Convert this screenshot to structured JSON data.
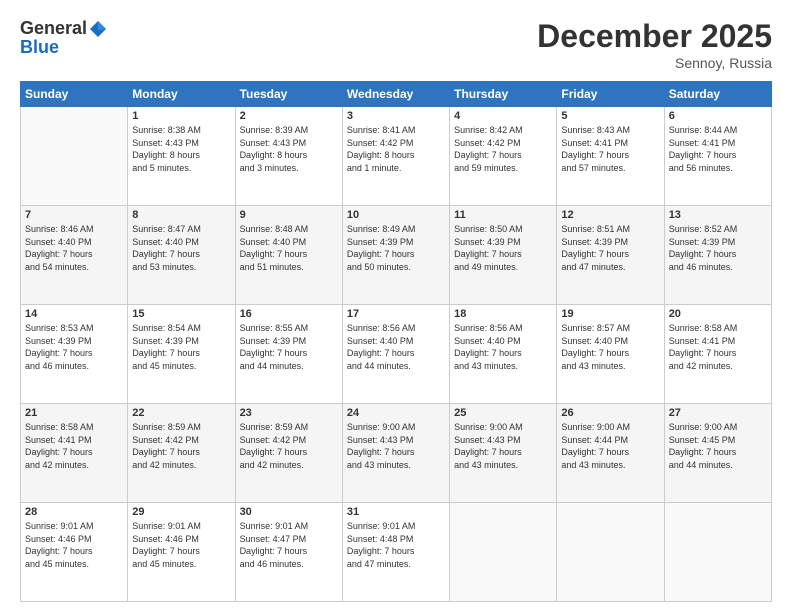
{
  "logo": {
    "general": "General",
    "blue": "Blue"
  },
  "header": {
    "title": "December 2025",
    "location": "Sennoy, Russia"
  },
  "weekdays": [
    "Sunday",
    "Monday",
    "Tuesday",
    "Wednesday",
    "Thursday",
    "Friday",
    "Saturday"
  ],
  "weeks": [
    [
      {
        "day": "",
        "info": ""
      },
      {
        "day": "1",
        "info": "Sunrise: 8:38 AM\nSunset: 4:43 PM\nDaylight: 8 hours\nand 5 minutes."
      },
      {
        "day": "2",
        "info": "Sunrise: 8:39 AM\nSunset: 4:43 PM\nDaylight: 8 hours\nand 3 minutes."
      },
      {
        "day": "3",
        "info": "Sunrise: 8:41 AM\nSunset: 4:42 PM\nDaylight: 8 hours\nand 1 minute."
      },
      {
        "day": "4",
        "info": "Sunrise: 8:42 AM\nSunset: 4:42 PM\nDaylight: 7 hours\nand 59 minutes."
      },
      {
        "day": "5",
        "info": "Sunrise: 8:43 AM\nSunset: 4:41 PM\nDaylight: 7 hours\nand 57 minutes."
      },
      {
        "day": "6",
        "info": "Sunrise: 8:44 AM\nSunset: 4:41 PM\nDaylight: 7 hours\nand 56 minutes."
      }
    ],
    [
      {
        "day": "7",
        "info": "Sunrise: 8:46 AM\nSunset: 4:40 PM\nDaylight: 7 hours\nand 54 minutes."
      },
      {
        "day": "8",
        "info": "Sunrise: 8:47 AM\nSunset: 4:40 PM\nDaylight: 7 hours\nand 53 minutes."
      },
      {
        "day": "9",
        "info": "Sunrise: 8:48 AM\nSunset: 4:40 PM\nDaylight: 7 hours\nand 51 minutes."
      },
      {
        "day": "10",
        "info": "Sunrise: 8:49 AM\nSunset: 4:39 PM\nDaylight: 7 hours\nand 50 minutes."
      },
      {
        "day": "11",
        "info": "Sunrise: 8:50 AM\nSunset: 4:39 PM\nDaylight: 7 hours\nand 49 minutes."
      },
      {
        "day": "12",
        "info": "Sunrise: 8:51 AM\nSunset: 4:39 PM\nDaylight: 7 hours\nand 47 minutes."
      },
      {
        "day": "13",
        "info": "Sunrise: 8:52 AM\nSunset: 4:39 PM\nDaylight: 7 hours\nand 46 minutes."
      }
    ],
    [
      {
        "day": "14",
        "info": "Sunrise: 8:53 AM\nSunset: 4:39 PM\nDaylight: 7 hours\nand 46 minutes."
      },
      {
        "day": "15",
        "info": "Sunrise: 8:54 AM\nSunset: 4:39 PM\nDaylight: 7 hours\nand 45 minutes."
      },
      {
        "day": "16",
        "info": "Sunrise: 8:55 AM\nSunset: 4:39 PM\nDaylight: 7 hours\nand 44 minutes."
      },
      {
        "day": "17",
        "info": "Sunrise: 8:56 AM\nSunset: 4:40 PM\nDaylight: 7 hours\nand 44 minutes."
      },
      {
        "day": "18",
        "info": "Sunrise: 8:56 AM\nSunset: 4:40 PM\nDaylight: 7 hours\nand 43 minutes."
      },
      {
        "day": "19",
        "info": "Sunrise: 8:57 AM\nSunset: 4:40 PM\nDaylight: 7 hours\nand 43 minutes."
      },
      {
        "day": "20",
        "info": "Sunrise: 8:58 AM\nSunset: 4:41 PM\nDaylight: 7 hours\nand 42 minutes."
      }
    ],
    [
      {
        "day": "21",
        "info": "Sunrise: 8:58 AM\nSunset: 4:41 PM\nDaylight: 7 hours\nand 42 minutes."
      },
      {
        "day": "22",
        "info": "Sunrise: 8:59 AM\nSunset: 4:42 PM\nDaylight: 7 hours\nand 42 minutes."
      },
      {
        "day": "23",
        "info": "Sunrise: 8:59 AM\nSunset: 4:42 PM\nDaylight: 7 hours\nand 42 minutes."
      },
      {
        "day": "24",
        "info": "Sunrise: 9:00 AM\nSunset: 4:43 PM\nDaylight: 7 hours\nand 43 minutes."
      },
      {
        "day": "25",
        "info": "Sunrise: 9:00 AM\nSunset: 4:43 PM\nDaylight: 7 hours\nand 43 minutes."
      },
      {
        "day": "26",
        "info": "Sunrise: 9:00 AM\nSunset: 4:44 PM\nDaylight: 7 hours\nand 43 minutes."
      },
      {
        "day": "27",
        "info": "Sunrise: 9:00 AM\nSunset: 4:45 PM\nDaylight: 7 hours\nand 44 minutes."
      }
    ],
    [
      {
        "day": "28",
        "info": "Sunrise: 9:01 AM\nSunset: 4:46 PM\nDaylight: 7 hours\nand 45 minutes."
      },
      {
        "day": "29",
        "info": "Sunrise: 9:01 AM\nSunset: 4:46 PM\nDaylight: 7 hours\nand 45 minutes."
      },
      {
        "day": "30",
        "info": "Sunrise: 9:01 AM\nSunset: 4:47 PM\nDaylight: 7 hours\nand 46 minutes."
      },
      {
        "day": "31",
        "info": "Sunrise: 9:01 AM\nSunset: 4:48 PM\nDaylight: 7 hours\nand 47 minutes."
      },
      {
        "day": "",
        "info": ""
      },
      {
        "day": "",
        "info": ""
      },
      {
        "day": "",
        "info": ""
      }
    ]
  ]
}
